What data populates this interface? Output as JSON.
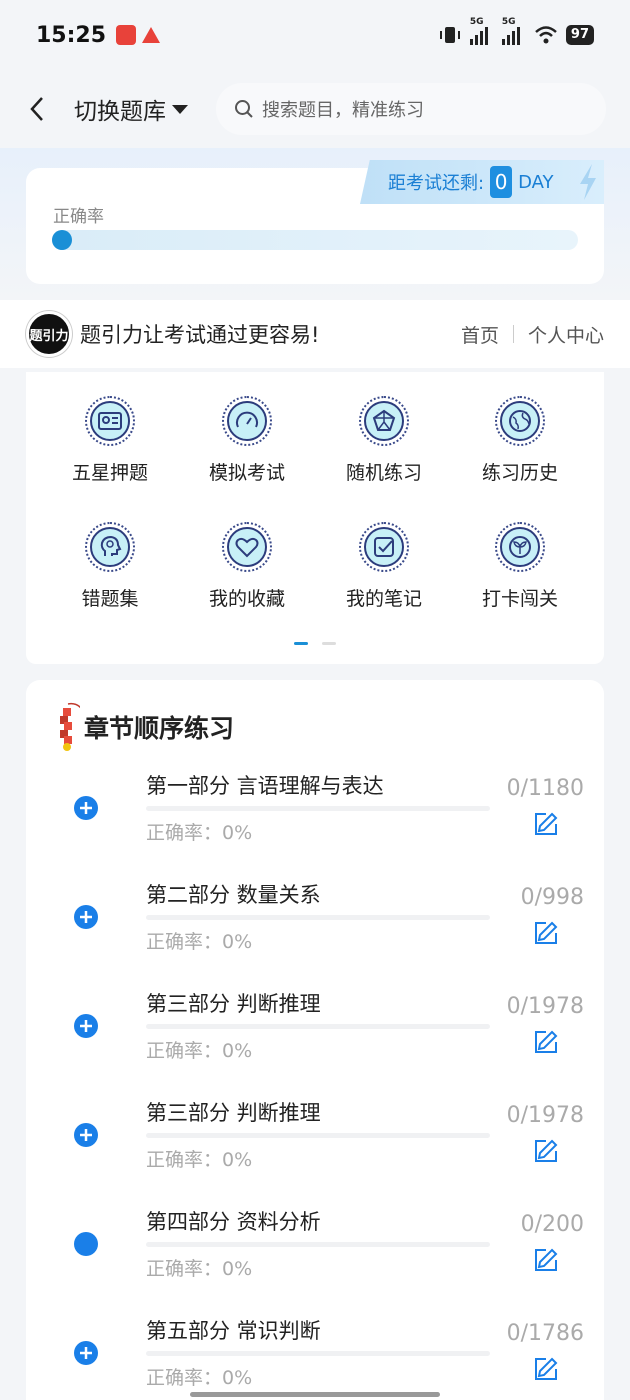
{
  "status": {
    "time": "15:25",
    "network1": "5G",
    "network2": "5G",
    "battery": "97"
  },
  "header": {
    "switch_label": "切换题库",
    "search_placeholder": "搜索题目，精准练习"
  },
  "accuracy": {
    "label": "正确率",
    "value_fraction": 0
  },
  "exam_countdown": {
    "prefix": "距考试还剩:",
    "days": "0",
    "unit": "DAY"
  },
  "slogan": {
    "logo_text": "题引力",
    "text": "题引力让考试通过更容易!",
    "links": [
      "首页",
      "个人中心"
    ]
  },
  "grid": {
    "items": [
      {
        "label": "五星押题",
        "icon": "id-card-icon"
      },
      {
        "label": "模拟考试",
        "icon": "gauge-icon"
      },
      {
        "label": "随机练习",
        "icon": "network-icon"
      },
      {
        "label": "练习历史",
        "icon": "globe-icon"
      },
      {
        "label": "错题集",
        "icon": "head-icon"
      },
      {
        "label": "我的收藏",
        "icon": "heart-icon"
      },
      {
        "label": "我的笔记",
        "icon": "note-icon"
      },
      {
        "label": "打卡闯关",
        "icon": "sprout-icon"
      }
    ],
    "page_count": 2,
    "active_page": 1
  },
  "chapters": {
    "title": "章节顺序练习",
    "items": [
      {
        "name": "第一部分 言语理解与表达",
        "accuracy": "正确率：0%",
        "count": "0/1180",
        "expandable": true
      },
      {
        "name": "第二部分 数量关系",
        "accuracy": "正确率：0%",
        "count": "0/998",
        "expandable": true
      },
      {
        "name": "第三部分 判断推理",
        "accuracy": "正确率：0%",
        "count": "0/1978",
        "expandable": true
      },
      {
        "name": "第三部分 判断推理",
        "accuracy": "正确率：0%",
        "count": "0/1978",
        "expandable": true
      },
      {
        "name": "第四部分 资料分析",
        "accuracy": "正确率：0%",
        "count": "0/200",
        "expandable": false
      },
      {
        "name": "第五部分 常识判断",
        "accuracy": "正确率：0%",
        "count": "0/1786",
        "expandable": true
      }
    ]
  },
  "colors": {
    "accent": "#1a7fe8",
    "progress": "#1a8fd6",
    "muted_text": "#aaaaaa"
  }
}
